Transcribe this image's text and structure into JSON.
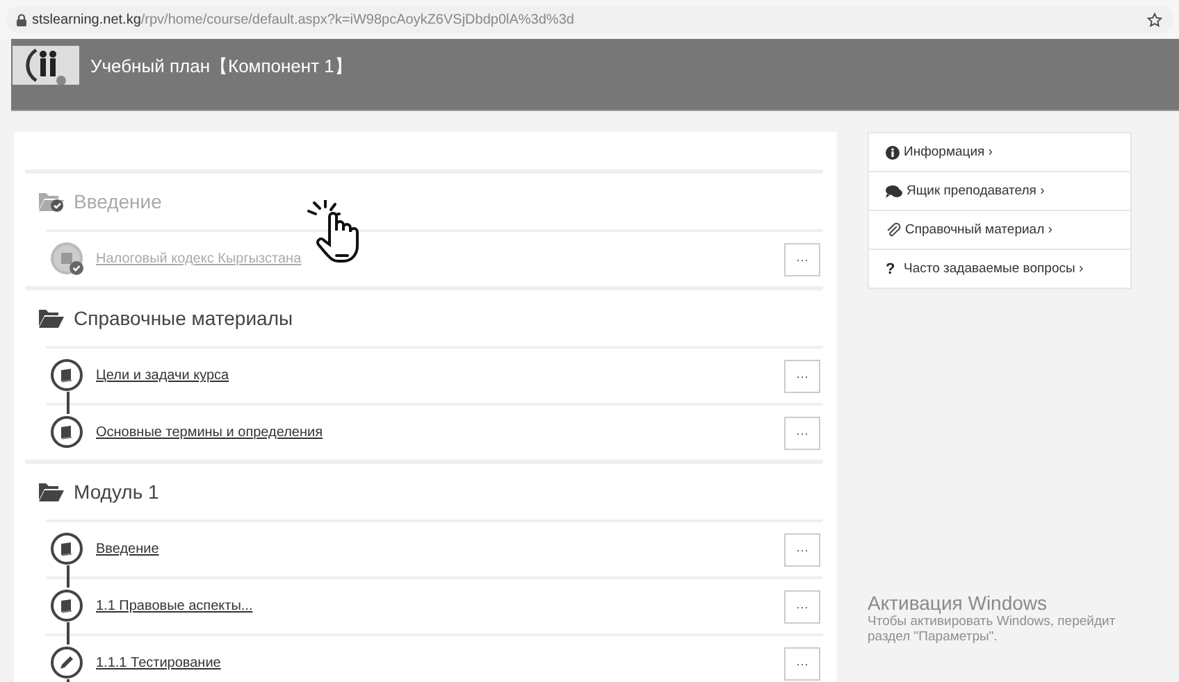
{
  "browser": {
    "url_host": "stslearning.net.kg",
    "url_path": "/rpv/home/course/default.aspx?k=iW98pcAoykZ6VSjDbdp0lA%3d%3d"
  },
  "header": {
    "title": "Учебный план【Компонент 1】"
  },
  "sections": [
    {
      "title": "Введение",
      "completed": true,
      "continues": false,
      "items": [
        {
          "title": "Налоговый кодекс Кыргызстана",
          "kind": "book",
          "completed": true,
          "menu": "···"
        }
      ]
    },
    {
      "title": "Справочные материалы",
      "completed": false,
      "continues": false,
      "items": [
        {
          "title": "Цели и задачи курса",
          "kind": "book",
          "completed": false,
          "menu": "···"
        },
        {
          "title": "Основные термины и определения",
          "kind": "book",
          "completed": false,
          "menu": "···"
        }
      ]
    },
    {
      "title": "Модуль 1",
      "completed": false,
      "continues": true,
      "items": [
        {
          "title": "Введение",
          "kind": "book",
          "completed": false,
          "menu": "···"
        },
        {
          "title": "1.1 Правовые аспекты...",
          "kind": "book",
          "completed": false,
          "menu": "···"
        },
        {
          "title": "1.1.1 Тестирование",
          "kind": "pencil",
          "completed": false,
          "menu": "···"
        }
      ]
    }
  ],
  "sidebar": [
    {
      "label": "Информация ›",
      "kind": "info"
    },
    {
      "label": "Ящик преподавателя ›",
      "kind": "chat"
    },
    {
      "label": "Справочный материал ›",
      "kind": "clip"
    },
    {
      "label": "Часто задаваемые вопросы ›",
      "kind": "glyph",
      "glyph": "?"
    }
  ],
  "activation": {
    "title": "Активация Windows",
    "text_1": "Чтобы активировать Windows, перейдит",
    "text_2": "раздел \"Параметры\"."
  }
}
